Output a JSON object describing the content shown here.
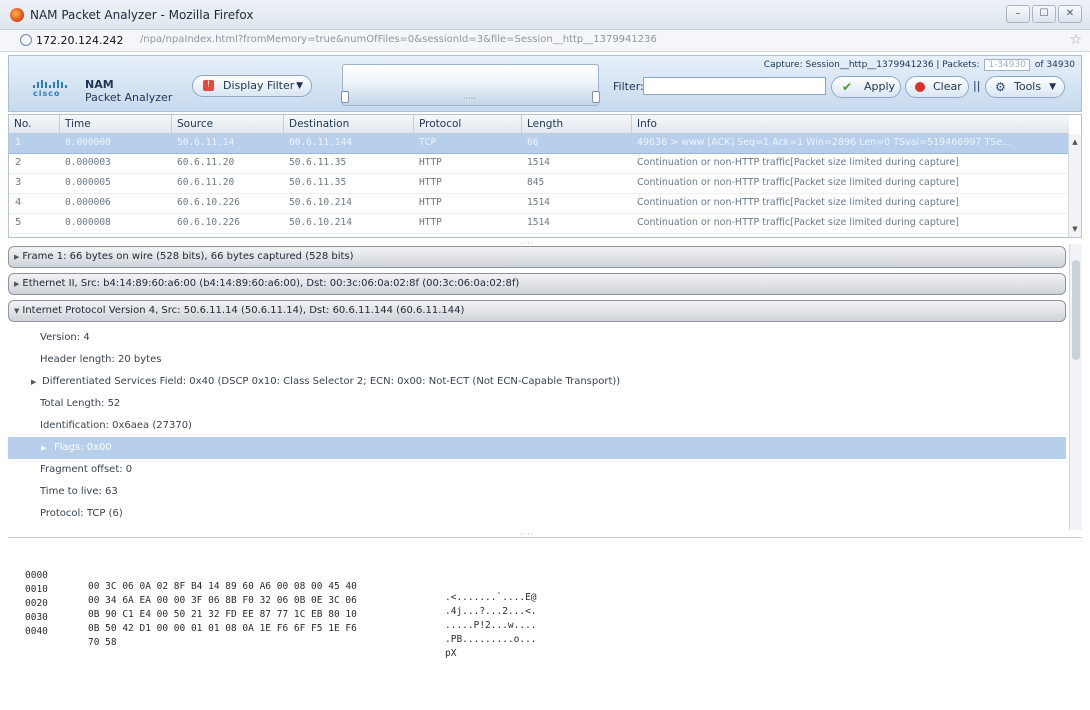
{
  "window": {
    "title": "NAM Packet Analyzer - Mozilla Firefox",
    "controls": [
      "–",
      "☐",
      "✕"
    ]
  },
  "urlbar": {
    "host": "172.20.124.242",
    "path": "/npa/npaIndex.html?fromMemory=true&numOfFiles=0&sessionId=3&file=Session__http__1379941236"
  },
  "app": {
    "brand": "cisco",
    "name": "NAM",
    "subtitle": "Packet Analyzer",
    "display_filter_label": "Display Filter",
    "filter_label": "Filter:",
    "filter_value": "",
    "capture_text": "Capture: Session__http__1379941236 | Packets:",
    "packets_range": "1-34930",
    "packets_total": "of 34930",
    "apply_label": "Apply",
    "clear_label": "Clear",
    "separator": "||",
    "tools_label": "Tools"
  },
  "packet_list": {
    "columns": [
      "No.",
      "Time",
      "Source",
      "Destination",
      "Protocol",
      "Length",
      "Info"
    ],
    "rows": [
      {
        "no": "1",
        "time": "0.000000",
        "src": "50.6.11.14",
        "dst": "60.6.11.144",
        "proto": "TCP",
        "len": "66",
        "info": "49636 > www [ACK] Seq=1 Ack=1 Win=2896 Len=0 TSval=519466997 TSe...",
        "selected": true
      },
      {
        "no": "2",
        "time": "0.000003",
        "src": "60.6.11.20",
        "dst": "50.6.11.35",
        "proto": "HTTP",
        "len": "1514",
        "info": "Continuation or non-HTTP traffic[Packet size limited during capture]",
        "selected": false
      },
      {
        "no": "3",
        "time": "0.000005",
        "src": "60.6.11.20",
        "dst": "50.6.11.35",
        "proto": "HTTP",
        "len": "845",
        "info": "Continuation or non-HTTP traffic[Packet size limited during capture]",
        "selected": false
      },
      {
        "no": "4",
        "time": "0.000006",
        "src": "60.6.10.226",
        "dst": "50.6.10.214",
        "proto": "HTTP",
        "len": "1514",
        "info": "Continuation or non-HTTP traffic[Packet size limited during capture]",
        "selected": false
      },
      {
        "no": "5",
        "time": "0.000008",
        "src": "60.6.10.226",
        "dst": "50.6.10.214",
        "proto": "HTTP",
        "len": "1514",
        "info": "Continuation or non-HTTP traffic[Packet size limited during capture]",
        "selected": false
      }
    ]
  },
  "details": {
    "groups": [
      "Frame 1: 66 bytes on wire (528 bits), 66 bytes captured (528 bits)",
      "Ethernet II, Src: b4:14:89:60:a6:00 (b4:14:89:60:a6:00), Dst: 00:3c:06:0a:02:8f (00:3c:06:0a:02:8f)",
      "Internet Protocol Version 4, Src: 50.6.11.14 (50.6.11.14), Dst: 60.6.11.144 (60.6.11.144)"
    ],
    "fields": [
      {
        "text": "Version: 4",
        "expander": false,
        "selected": false
      },
      {
        "text": "Header length: 20 bytes",
        "expander": false,
        "selected": false
      },
      {
        "text": "Differentiated Services Field: 0x40 (DSCP 0x10: Class Selector 2; ECN: 0x00: Not-ECT (Not ECN-Capable Transport))",
        "expander": true,
        "selected": false
      },
      {
        "text": "Total Length: 52",
        "expander": false,
        "selected": false
      },
      {
        "text": "Identification: 0x6aea (27370)",
        "expander": false,
        "selected": false
      },
      {
        "text": "Flags: 0x00",
        "expander": true,
        "selected": true
      },
      {
        "text": "Fragment offset: 0",
        "expander": false,
        "selected": false
      },
      {
        "text": "Time to live: 63",
        "expander": false,
        "selected": false
      },
      {
        "text": "Protocol: TCP (6)",
        "expander": false,
        "selected": false
      }
    ]
  },
  "hex": {
    "lines": [
      {
        "offset": "0000",
        "bytes": "00 3C 06 0A 02 8F B4 14 89 60 A6 00 08 00 45 40",
        "ascii": ".<.......`....E@"
      },
      {
        "offset": "0010",
        "bytes": "00 34 6A EA 00 00 3F 06 8B F0 32 06 0B 0E 3C 06",
        "ascii": ".4j...?...2...<."
      },
      {
        "offset": "0020",
        "bytes": "0B 90 C1 E4 00 50 21 32 FD EE 87 77 1C EB 80 10",
        "ascii": ".....P!2...w...."
      },
      {
        "offset": "0030",
        "bytes": "0B 50 42 D1 00 00 01 01 08 0A 1E F6 6F F5 1E F6",
        "ascii": ".PB.........o..."
      },
      {
        "offset": "0040",
        "bytes": "70 58",
        "ascii": "pX"
      }
    ]
  }
}
